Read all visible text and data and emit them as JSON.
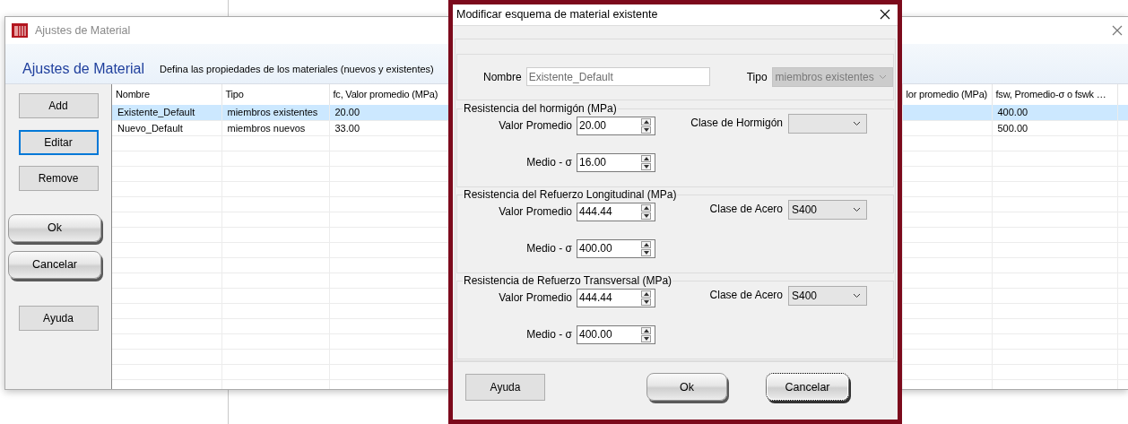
{
  "main_window": {
    "title": "Ajustes de Material"
  },
  "header": {
    "title": "Ajustes de Material",
    "subtitle": "Defina las propiedades de los materiales (nuevos y existentes)"
  },
  "side_buttons": [
    {
      "label": "Add",
      "kind": "flat",
      "focused": false
    },
    {
      "label": "Editar",
      "kind": "flat",
      "focused": true
    },
    {
      "label": "Remove",
      "kind": "flat",
      "focused": false
    },
    {
      "label": "Ok",
      "kind": "glossy",
      "focused": false
    },
    {
      "label": "Cancelar",
      "kind": "glossy",
      "focused": false
    },
    {
      "label": "Ayuda",
      "kind": "flat",
      "focused": false
    }
  ],
  "table": {
    "columns": [
      "Nombre",
      "Tipo",
      "fc, Valor promedio (MPa)",
      "lor promedio (MPa)",
      "fsw, Promedio-σ o fswk …"
    ],
    "rows": [
      {
        "selected": true,
        "nombre": "Existente_Default",
        "tipo": "miembros existentes",
        "fc": "20.00",
        "fsw": "400.00"
      },
      {
        "selected": false,
        "nombre": "Nuevo_Default",
        "tipo": "miembros nuevos",
        "fc": "33.00",
        "fsw": "500.00"
      }
    ]
  },
  "dialog": {
    "title": "Modificar esquema de material existente",
    "nombre": {
      "label": "Nombre",
      "value": "Existente_Default",
      "disabled": true
    },
    "tipo": {
      "label": "Tipo",
      "value": "miembros existentes",
      "disabled": true
    },
    "groups": [
      {
        "title": "Resistencia del hormigón (MPa)",
        "class_label": "Clase de Hormigón",
        "fields": [
          {
            "label": "Valor Promedio",
            "value": "20.00"
          },
          {
            "label": "Medio - σ",
            "value": "16.00"
          }
        ]
      },
      {
        "title": "Resistencia del Refuerzo Longitudinal (MPa)",
        "class_label": "Clase de Acero",
        "class_value": "S400",
        "fields": [
          {
            "label": "Valor Promedio",
            "value": "444.44"
          },
          {
            "label": "Medio - σ",
            "value": "400.00"
          }
        ]
      },
      {
        "title": "Resistencia de Refuerzo Transversal (MPa)",
        "class_label": "Clase de Acero",
        "class_value": "S400",
        "fields": [
          {
            "label": "Valor Promedio",
            "value": "444.44"
          },
          {
            "label": "Medio - σ",
            "value": "400.00"
          }
        ]
      }
    ],
    "buttons": [
      {
        "label": "Ayuda",
        "kind": "flat",
        "focused": false
      },
      {
        "label": "Ok",
        "kind": "glossy",
        "focused": false
      },
      {
        "label": "Cancelar",
        "kind": "glossy",
        "focused": true
      }
    ]
  }
}
